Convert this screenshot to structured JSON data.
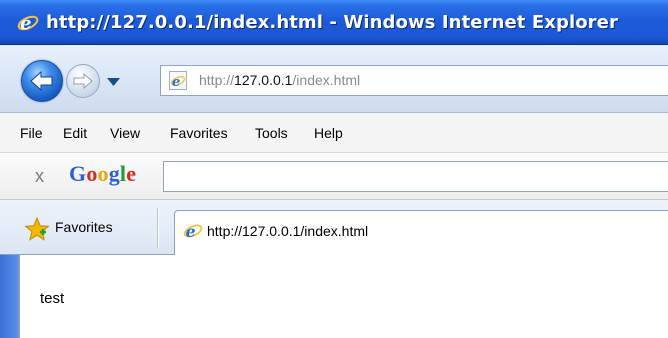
{
  "window": {
    "title": "http://127.0.0.1/index.html - Windows Internet Explorer",
    "title_icon": "ie-logo-icon"
  },
  "navigation": {
    "back_icon": "back-arrow-icon",
    "forward_icon": "forward-arrow-icon",
    "history_icon": "chevron-down-icon"
  },
  "address_bar": {
    "scheme": "http://",
    "host": "127.0.0.1",
    "path": "/index.html",
    "page_icon": "ie-page-icon"
  },
  "menu": {
    "items": [
      "File",
      "Edit",
      "View",
      "Favorites",
      "Tools",
      "Help"
    ]
  },
  "google_toolbar": {
    "close_label": "x",
    "logo_letters": [
      "G",
      "o",
      "o",
      "g",
      "l",
      "e"
    ],
    "logo_colors": [
      "#2b5fd9",
      "#d62c1f",
      "#e8a60a",
      "#2b5fd9",
      "#1e9b3c",
      "#d62c1f"
    ],
    "search_value": ""
  },
  "favorites_bar": {
    "label": "Favorites",
    "star_icon": "favorites-star-icon"
  },
  "tab": {
    "label": "http://127.0.0.1/index.html",
    "icon": "ie-page-icon"
  },
  "page": {
    "text": "test"
  },
  "colors": {
    "titlebar": "#1c5ad8",
    "frame_border": "#7f9db9",
    "star": "#f5b800"
  }
}
